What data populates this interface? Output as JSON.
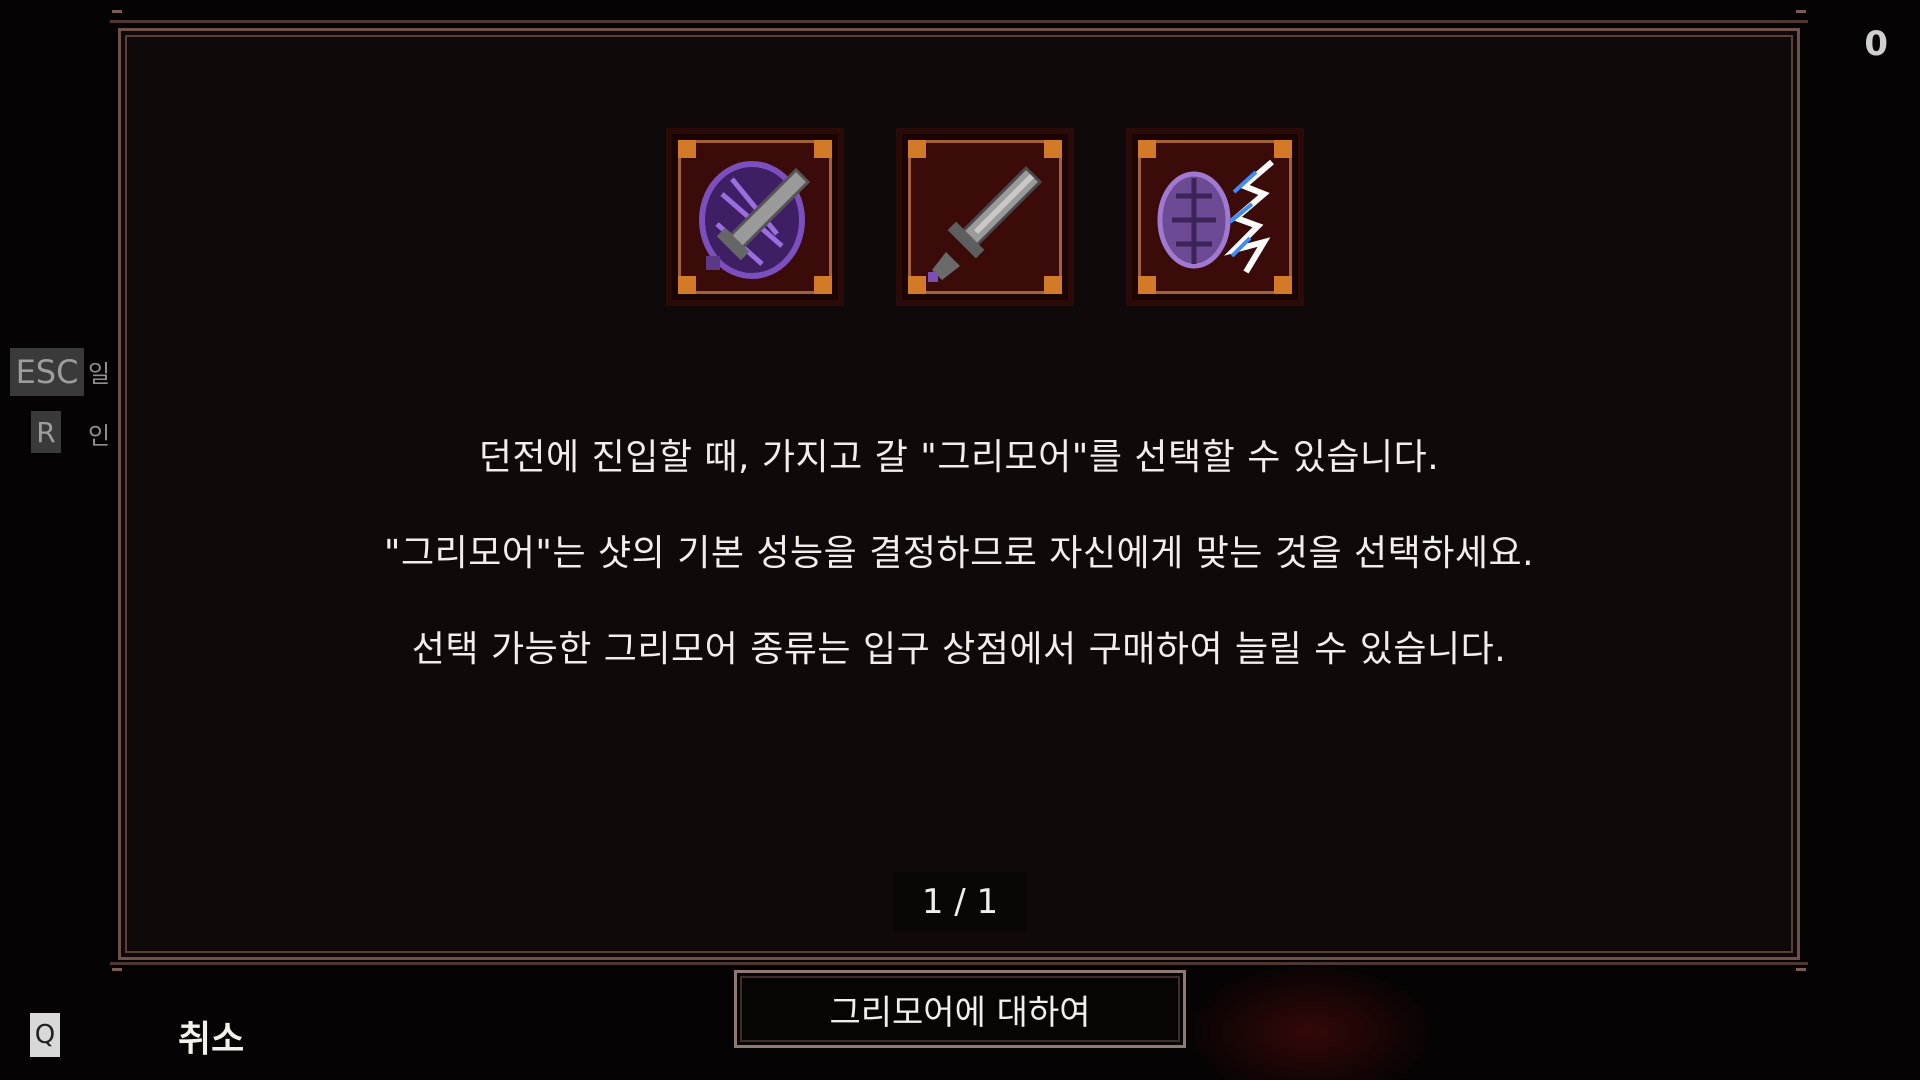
{
  "hud": {
    "score": "0"
  },
  "hotkeys": {
    "esc": {
      "key": "ESC",
      "label": "일"
    },
    "r": {
      "key": "R",
      "label": "인"
    },
    "q": {
      "key": "Q",
      "label": "취소"
    }
  },
  "grimoire_icons": [
    {
      "name": "dark-shield-sword-grimoire-icon"
    },
    {
      "name": "sword-grimoire-icon"
    },
    {
      "name": "lightning-shield-grimoire-icon"
    }
  ],
  "description": {
    "line1": "던전에 진입할 때, 가지고 갈 \"그리모어\"를 선택할 수 있습니다.",
    "line2": "\"그리모어\"는 샷의 기본 성능을 결정하므로 자신에게 맞는 것을 선택하세요.",
    "line3": "선택 가능한 그리모어 종류는 입구 상점에서 구매하여 늘릴 수 있습니다."
  },
  "pagination": {
    "text": "1 / 1"
  },
  "about_button": {
    "label": "그리모어에 대하여"
  },
  "colors": {
    "frame": "#6e5148",
    "icon_corner": "#d27a28",
    "icon_bg": "#3a0b09",
    "purple": "#8a5ad0"
  }
}
